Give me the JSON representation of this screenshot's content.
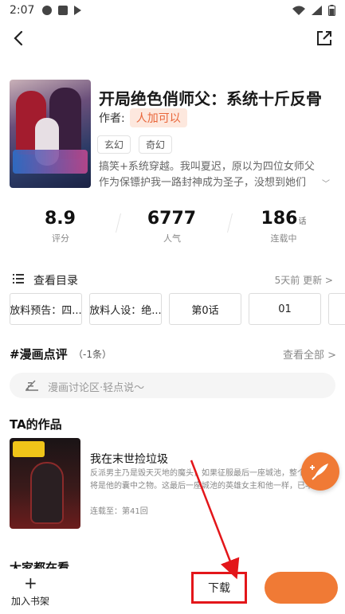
{
  "status_bar": {
    "time": "2:07",
    "battery_level": 0.8
  },
  "book": {
    "title": "开局绝色俏师父：系统十斤反骨",
    "author_label": "作者:",
    "author": "人加可以",
    "tags": [
      "玄幻",
      "奇幻"
    ],
    "description": "搞笑+系统穿越。我叫夏迟，原以为四位女师父作为保镖护我一路封神成为圣子，没想到她们各..."
  },
  "stats": [
    {
      "value": "8.9",
      "unit": "",
      "label": "评分"
    },
    {
      "value": "6777",
      "unit": "",
      "label": "人气"
    },
    {
      "value": "186",
      "unit": "话",
      "label": "连载中"
    }
  ],
  "catalog": {
    "title": "查看目录",
    "update": "5天前 更新 >",
    "chapters": [
      "放料预告：四...",
      "放料人设：绝...",
      "第0话",
      "01",
      ""
    ]
  },
  "review": {
    "title": "#漫画点评",
    "count": "（-1条）",
    "view_all": "查看全部 >",
    "placeholder": "漫画讨论区·轻点说～"
  },
  "works": {
    "section_title": "TA的作品",
    "items": [
      {
        "title": "我在末世捡垃圾",
        "description": "反派男主乃是毁天灭地的魔头，如果征服最后一座城池，整个大陆都将是他的囊中之物。这最后一座城池的英雄女主和他一样，已半步成神...",
        "status": "连载至：第41回"
      }
    ]
  },
  "next_section_title": "大家都在看",
  "bottom_bar": {
    "add_shelf_label": "加入书架",
    "download_label": "下载",
    "read_label": ""
  },
  "colors": {
    "accent": "#f07a35",
    "highlight_box": "#e3161a",
    "author_bg": "#fde8de"
  }
}
